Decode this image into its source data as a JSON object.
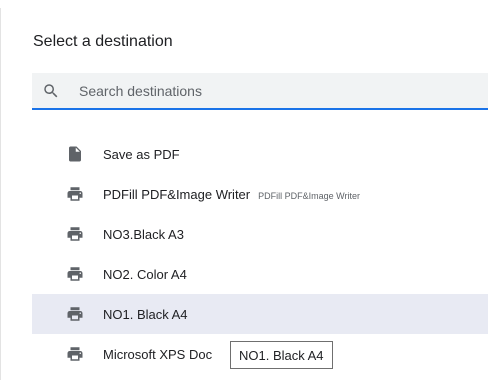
{
  "dialog": {
    "title": "Select a destination"
  },
  "search": {
    "placeholder": "Search destinations",
    "value": ""
  },
  "destinations": [
    {
      "label": "Save as PDF",
      "sublabel": "",
      "icon": "pdf-file-icon"
    },
    {
      "label": "PDFill PDF&Image Writer",
      "sublabel": "PDFill PDF&Image Writer",
      "icon": "printer-icon"
    },
    {
      "label": "NO3.Black A3",
      "sublabel": "",
      "icon": "printer-icon"
    },
    {
      "label": "NO2. Color A4",
      "sublabel": "",
      "icon": "printer-icon"
    },
    {
      "label": "NO1. Black A4",
      "sublabel": "",
      "icon": "printer-icon",
      "selected": true
    },
    {
      "label": "Microsoft XPS Doc",
      "sublabel": "",
      "icon": "printer-icon"
    }
  ],
  "tooltip": {
    "text": "NO1. Black A4"
  },
  "colors": {
    "accent": "#1a73e8",
    "selected_bg": "#e8eaf3",
    "icon": "#5f6368"
  }
}
